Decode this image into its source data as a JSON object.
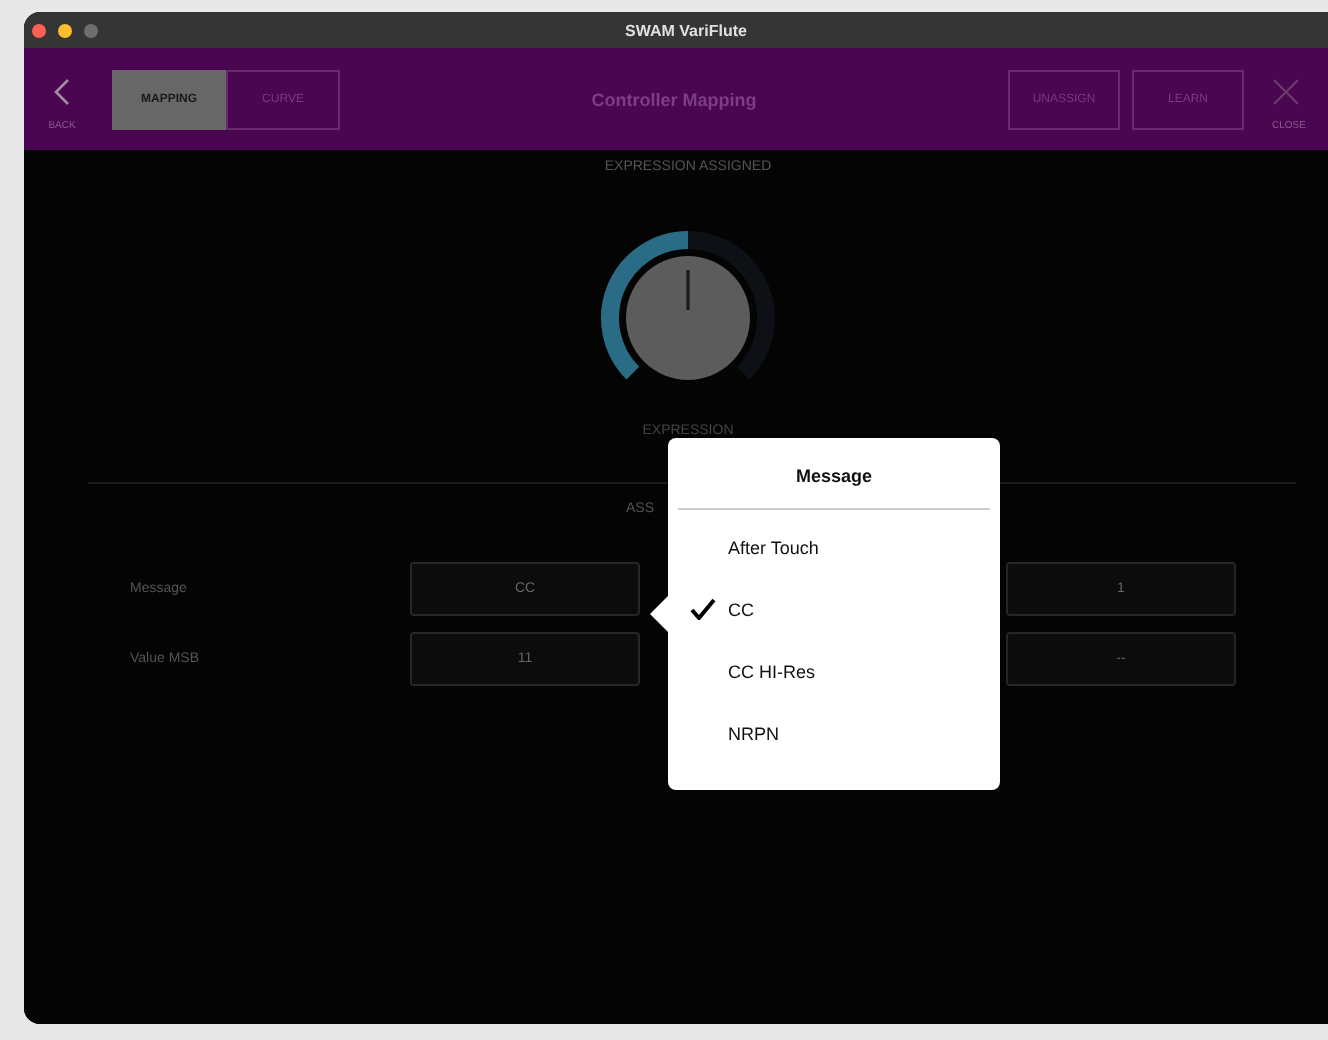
{
  "window": {
    "title": "SWAM VariFlute"
  },
  "header": {
    "back_label": "BACK",
    "tabs": [
      {
        "label": "MAPPING",
        "selected": true
      },
      {
        "label": "CURVE",
        "selected": false
      }
    ],
    "title": "Controller Mapping",
    "buttons": [
      "UNASSIGN",
      "LEARN"
    ],
    "close_label": "CLOSE"
  },
  "status": "EXPRESSION ASSIGNED",
  "knob": {
    "label": "EXPRESSION",
    "level": 0.5
  },
  "section_heading": "ASS",
  "rows": [
    {
      "label": "Message",
      "value": "CC",
      "value_2": "1"
    },
    {
      "label": "Value MSB",
      "value": "11",
      "value_2": "--"
    }
  ],
  "popup": {
    "title": "Message",
    "options": [
      {
        "label": "After Touch",
        "selected": false
      },
      {
        "label": "CC",
        "selected": true
      },
      {
        "label": "CC HI-Res",
        "selected": false
      },
      {
        "label": "NRPN",
        "selected": false
      }
    ]
  }
}
